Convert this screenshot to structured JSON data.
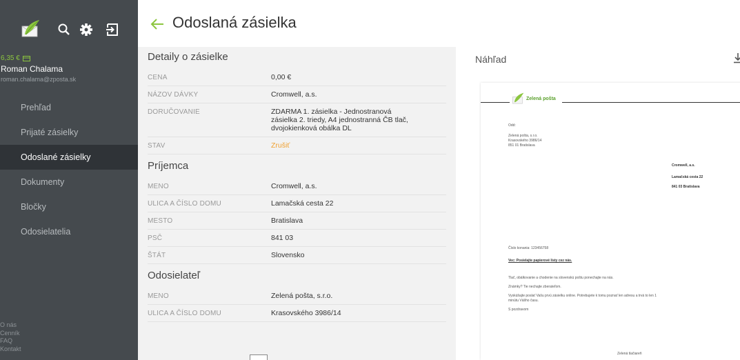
{
  "account": {
    "balance": "6,35 €",
    "name": "Roman Chalama",
    "email": "roman.chalama@zposta.sk"
  },
  "nav": [
    {
      "label": "Prehľad",
      "name": "nav-item-prehlad",
      "active": false
    },
    {
      "label": "Prijaté zásielky",
      "name": "nav-item-prijate-zasielky",
      "active": false
    },
    {
      "label": "Odoslané zásielky",
      "name": "nav-item-odoslane-zasielky",
      "active": true
    },
    {
      "label": "Dokumenty",
      "name": "nav-item-dokumenty",
      "active": false
    },
    {
      "label": "Bločky",
      "name": "nav-item-blocky",
      "active": false
    },
    {
      "label": "Odosielatelia",
      "name": "nav-item-odosielatelia",
      "active": false
    }
  ],
  "footer_links": [
    "O nás",
    "Cenník",
    "FAQ",
    "Kontakt"
  ],
  "header": {
    "title": "Odoslaná zásielka"
  },
  "details": {
    "sections": [
      {
        "title": "Detaily o zásielke",
        "rows": [
          {
            "label": "CENA",
            "value": "0,00 €"
          },
          {
            "label": "NÁZOV DÁVKY",
            "value": "Cromwell, a.s."
          },
          {
            "label": "DORUČOVANIE",
            "value": "ZDARMA 1. zásielka - Jednostranová zásielka 2. triedy, A4 jednostranná ČB tlač, dvojokienková obálka DL"
          },
          {
            "label": "STAV",
            "value": "Zrušiť",
            "accent": true
          }
        ]
      },
      {
        "title": "Príjemca",
        "rows": [
          {
            "label": "MENO",
            "value": "Cromwell, a.s."
          },
          {
            "label": "ULICA A ČÍSLO DOMU",
            "value": "Lamačská cesta 22"
          },
          {
            "label": "MESTO",
            "value": "Bratislava"
          },
          {
            "label": "PSČ",
            "value": "841 03"
          },
          {
            "label": "ŠTÁT",
            "value": "Slovensko"
          }
        ]
      },
      {
        "title": "Odosielateľ",
        "rows": [
          {
            "label": "MENO",
            "value": "Zelená pošta, s.r.o."
          },
          {
            "label": "ULICA A ČÍSLO DOMU",
            "value": "Krasovského 3986/14"
          }
        ]
      }
    ]
  },
  "preview": {
    "title": "Náhľad",
    "doc": {
      "brand": "Zelená pošta",
      "sender_lines": [
        "Odd:",
        "Zelená pošta, s.r.o.",
        "Krasovského 3986/14",
        "851 01 Bratislava"
      ],
      "recipient_lines": [
        "Cromwell, a.s.",
        "Lamačská cesta 22",
        "841 03 Bratislava"
      ],
      "body_lines": [
        "Číslo konania: 123456758",
        "Vec: Posielajte papierové listy cez nás.",
        "Tlač, obálkovanie a chodenie na slovenskú poštu ponechajte na nás.",
        "Známky? Tie nechajte zberateľom.",
        "Vyskúšajte poslať Vašu prvú zásielku online. Potrebujete k tomu poznať len adresu a trvá to len 1",
        "minútu Vášho času.",
        "S pozdravom",
        "Zelená tlačiareň"
      ]
    }
  },
  "colors": {
    "sidebar": "#454a4e",
    "active": "#2f3337",
    "accent_green": "#8cc63f",
    "status_orange": "#f0a030"
  }
}
